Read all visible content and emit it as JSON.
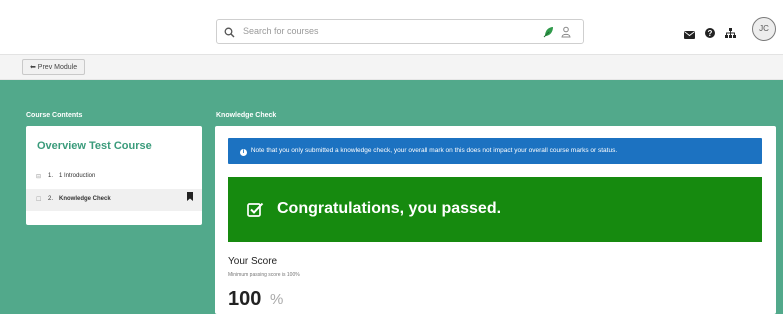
{
  "search": {
    "placeholder": "Search for courses"
  },
  "icons": {
    "search": "search-icon",
    "leaf": "leaf-icon",
    "person": "person-icon",
    "envelope": "envelope-icon",
    "help": "help-icon",
    "sitemap": "sitemap-icon",
    "bookmark": "bookmark-icon",
    "check": "checkbox-icon"
  },
  "user": {
    "initials": "JC"
  },
  "subbar": {
    "prev_label": "⬅ Prev Module"
  },
  "sidebar": {
    "heading": "Course Contents",
    "course_title": "Overview Test Course",
    "items": [
      {
        "icon": "⊟",
        "number": "1.",
        "label": "1 Introduction"
      },
      {
        "icon": "☐",
        "number": "2.",
        "label": "Knowledge Check"
      }
    ]
  },
  "main": {
    "heading": "Knowledge Check",
    "info_icon": "i",
    "note": "Note that you only submitted a knowledge check, your overall mark on this does not impact your overall course marks or status.",
    "success_message": "Congratulations, you passed.",
    "score_label": "Your Score",
    "score_sub": "Minimum passing score is 100%",
    "score_value": "100",
    "score_unit": "%"
  },
  "colors": {
    "accent_green": "#52a98b",
    "success_green": "#168a0f",
    "info_blue": "#1c72c1",
    "title_green": "#3a9b7b"
  }
}
